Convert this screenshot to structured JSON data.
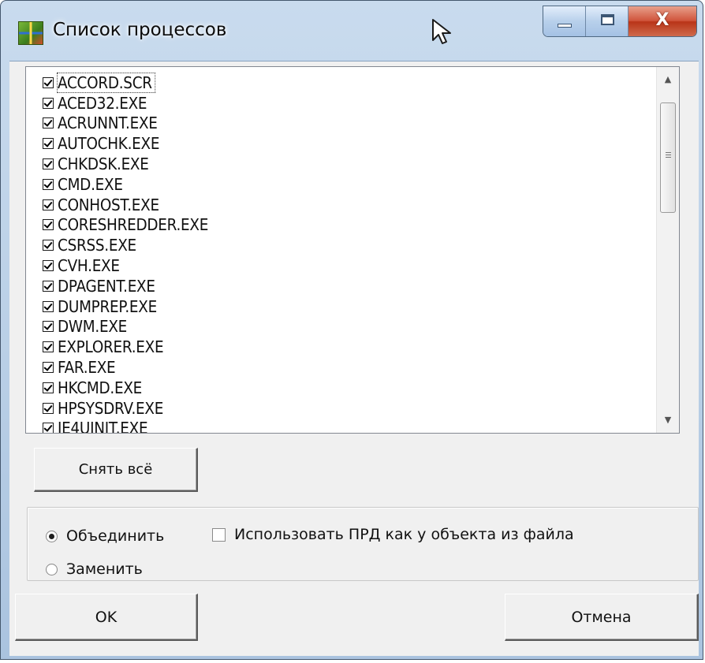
{
  "window": {
    "title": "Список процессов"
  },
  "processes": [
    {
      "name": "ACCORD.SCR",
      "checked": true
    },
    {
      "name": "ACED32.EXE",
      "checked": true
    },
    {
      "name": "ACRUNNT.EXE",
      "checked": true
    },
    {
      "name": "AUTOCHK.EXE",
      "checked": true
    },
    {
      "name": "CHKDSK.EXE",
      "checked": true
    },
    {
      "name": "CMD.EXE",
      "checked": true
    },
    {
      "name": "CONHOST.EXE",
      "checked": true
    },
    {
      "name": "CORESHREDDER.EXE",
      "checked": true
    },
    {
      "name": "CSRSS.EXE",
      "checked": true
    },
    {
      "name": "CVH.EXE",
      "checked": true
    },
    {
      "name": "DPAGENT.EXE",
      "checked": true
    },
    {
      "name": "DUMPREP.EXE",
      "checked": true
    },
    {
      "name": "DWM.EXE",
      "checked": true
    },
    {
      "name": "EXPLORER.EXE",
      "checked": true
    },
    {
      "name": "FAR.EXE",
      "checked": true
    },
    {
      "name": "HKCMD.EXE",
      "checked": true
    },
    {
      "name": "HPSYSDRV.EXE",
      "checked": true
    },
    {
      "name": "IE4UINIT.EXE",
      "checked": true
    }
  ],
  "buttons": {
    "uncheck_all": "Снять всё",
    "ok": "OK",
    "cancel": "Отмена"
  },
  "mode": {
    "merge_label": "Объединить",
    "replace_label": "Заменить",
    "selected": "merge"
  },
  "options": {
    "use_file_prd_label": "Использовать ПРД как у объекта из файла",
    "use_file_prd_checked": false
  }
}
